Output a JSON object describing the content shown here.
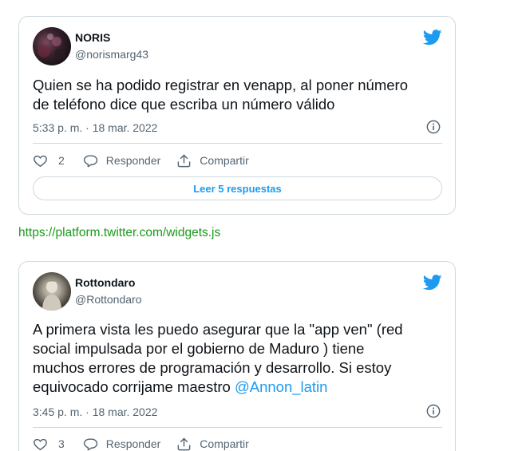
{
  "tweets": [
    {
      "display_name": "NORIS",
      "handle": "@norismarg43",
      "text": "Quien se ha podido registrar en venapp, al poner número\nde teléfono dice que escriba un número válido",
      "timestamp": "5:33 p. m. · 18 mar. 2022",
      "likes": "2",
      "reply_label": "Responder",
      "share_label": "Compartir",
      "read_replies_label": "Leer 5 respuestas"
    },
    {
      "display_name": "Rottondaro",
      "handle": "@Rottondaro",
      "text": "A primera vista les puedo asegurar que la \"app ven\" (red\nsocial impulsada por el gobierno de Maduro ) tiene\nmuchos errores de programación y desarrollo. Si estoy\nequivocado corrijame maestro ",
      "mention": "@Annon_latin",
      "timestamp": "3:45 p. m. · 18 mar. 2022",
      "likes": "3",
      "reply_label": "Responder",
      "share_label": "Compartir"
    }
  ],
  "widgets_link": "https://platform.twitter.com/widgets.js",
  "icons": {
    "brand": "twitter-bird-icon",
    "info": "info-icon",
    "like": "heart-icon",
    "reply": "speech-bubble-icon",
    "share": "share-icon"
  },
  "colors": {
    "accent": "#1d9bf0",
    "secondary_text": "#536471",
    "border": "#cfd9de",
    "link_green": "#1a9a1a"
  }
}
